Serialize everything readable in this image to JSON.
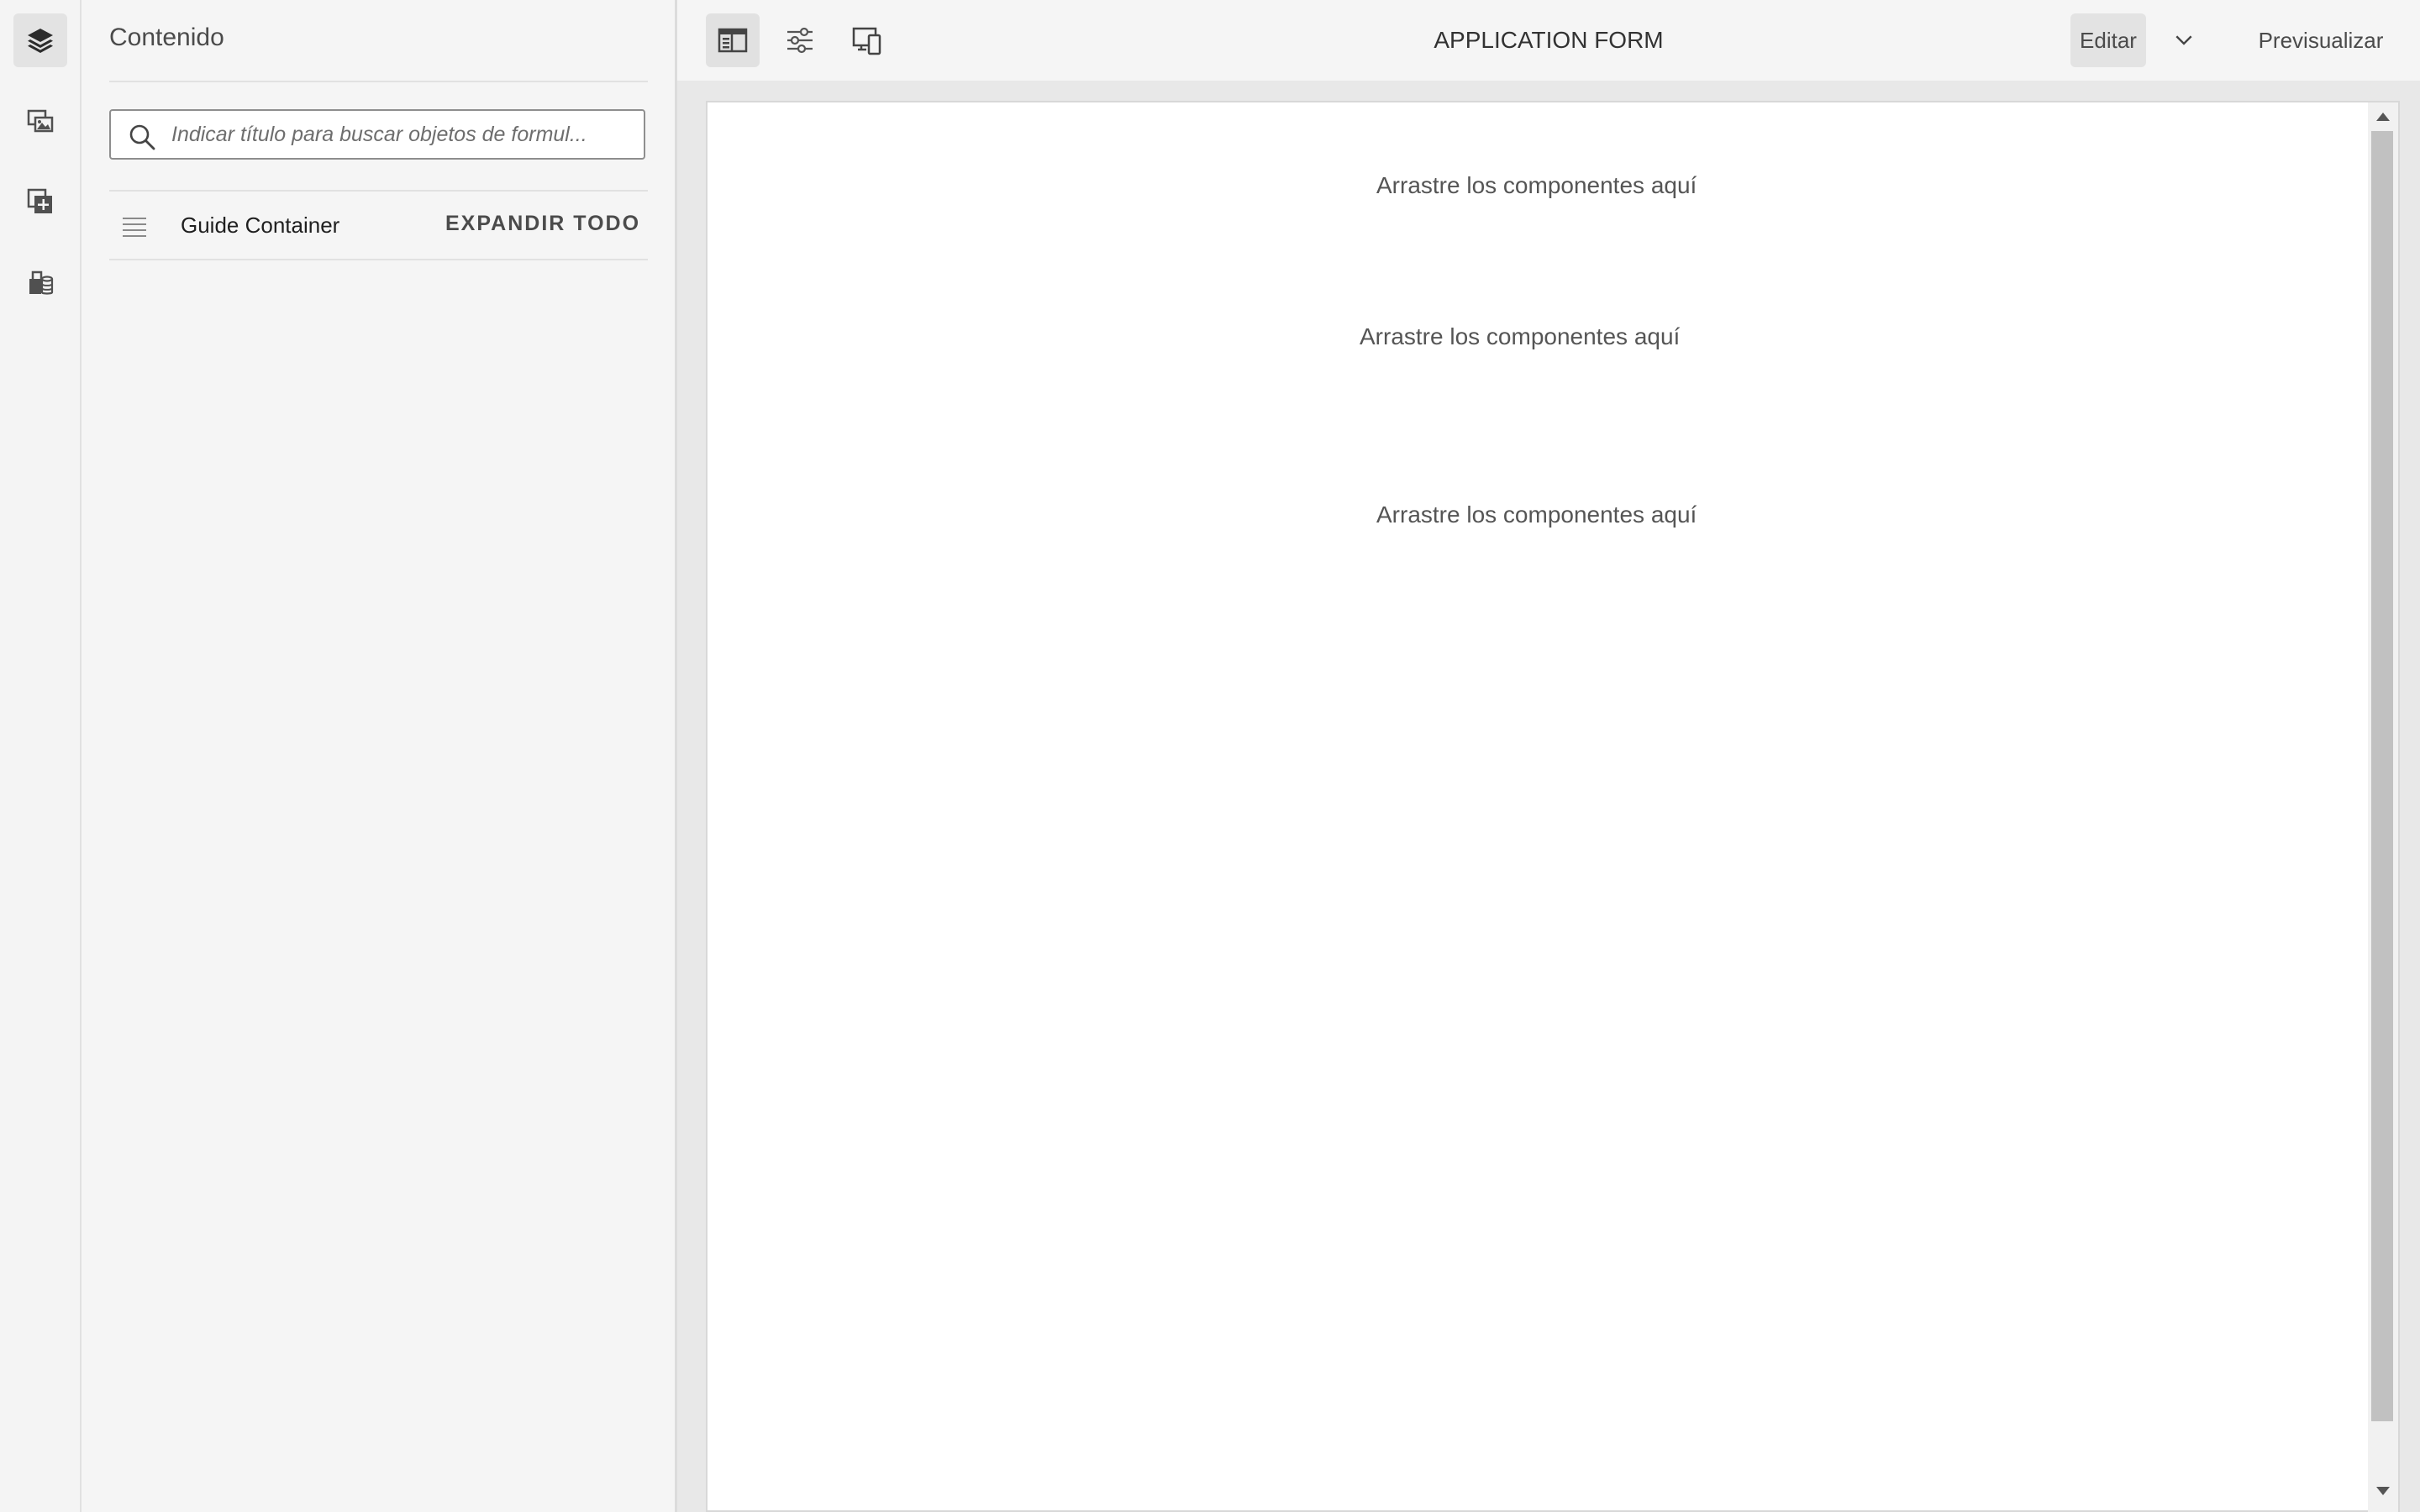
{
  "rail": {
    "items": [
      {
        "icon": "layers-icon"
      },
      {
        "icon": "assets-icon"
      },
      {
        "icon": "components-icon"
      },
      {
        "icon": "data-sources-icon"
      }
    ]
  },
  "panel": {
    "title": "Contenido",
    "search_placeholder": "Indicar título para buscar objetos de formul...",
    "tree": {
      "item_label": "Guide Container",
      "expand_label": "EXPANDIR TODO"
    }
  },
  "toolbar": {
    "page_title": "APPLICATION FORM",
    "edit_label": "Editar",
    "preview_label": "Previsualizar"
  },
  "canvas": {
    "drop_zones": [
      "Arrastre los componentes aquí",
      "Arrastre los componentes aquí",
      "Arrastre los componentes aquí"
    ]
  },
  "colors": {
    "background": "#f5f5f5",
    "canvas": "#ffffff",
    "active_button": "#e1e1e1"
  }
}
